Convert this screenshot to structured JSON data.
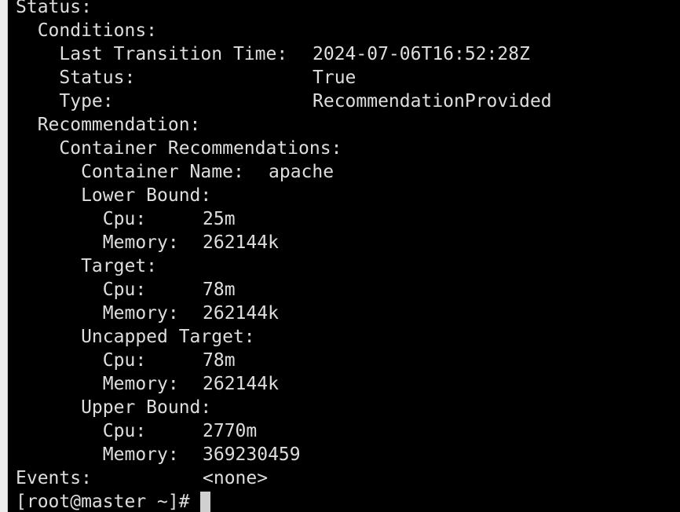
{
  "terminal": {
    "lines": [
      {
        "key": "Status:",
        "value": ""
      },
      {
        "key": "  Conditions:",
        "value": ""
      },
      {
        "key": "    Last Transition Time:",
        "value": "2024-07-06T16:52:28Z"
      },
      {
        "key": "    Status:",
        "value": "True"
      },
      {
        "key": "    Type:",
        "value": "RecommendationProvided"
      },
      {
        "key": "  Recommendation:",
        "value": ""
      },
      {
        "key": "    Container Recommendations:",
        "value": ""
      },
      {
        "key": "      Container Name:",
        "value": "apache"
      },
      {
        "key": "      Lower Bound:",
        "value": ""
      },
      {
        "key": "        Cpu:",
        "value": "25m"
      },
      {
        "key": "        Memory:",
        "value": "262144k"
      },
      {
        "key": "      Target:",
        "value": ""
      },
      {
        "key": "        Cpu:",
        "value": "78m"
      },
      {
        "key": "        Memory:",
        "value": "262144k"
      },
      {
        "key": "      Uncapped Target:",
        "value": ""
      },
      {
        "key": "        Cpu:",
        "value": "78m"
      },
      {
        "key": "        Memory:",
        "value": "262144k"
      },
      {
        "key": "      Upper Bound:",
        "value": ""
      },
      {
        "key": "        Cpu:",
        "value": "2770m"
      },
      {
        "key": "        Memory:",
        "value": "369230459"
      },
      {
        "key": "Events:",
        "value": "<none>"
      }
    ],
    "prompt": "[root@master ~]# "
  }
}
